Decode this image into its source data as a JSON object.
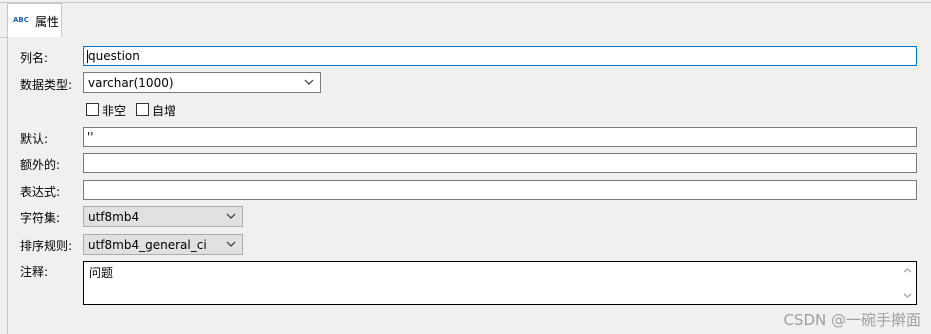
{
  "tab": {
    "icon_text": "ABC",
    "label": "属性"
  },
  "fields": {
    "column_name": {
      "label": "列名:",
      "value": "question"
    },
    "data_type": {
      "label": "数据类型:",
      "value": "varchar(1000)"
    },
    "not_null": {
      "label": "非空",
      "checked": false
    },
    "auto_increment": {
      "label": "自增",
      "checked": false
    },
    "default": {
      "label": "默认:",
      "value": "''"
    },
    "extra": {
      "label": "额外的:",
      "value": ""
    },
    "expression": {
      "label": "表达式:",
      "value": ""
    },
    "charset": {
      "label": "字符集:",
      "value": "utf8mb4"
    },
    "collation": {
      "label": "排序规则:",
      "value": "utf8mb4_general_ci"
    },
    "comment": {
      "label": "注释:",
      "value": "问题"
    }
  },
  "watermark": "CSDN @一碗手擀面",
  "colors": {
    "focus_border": "#0078d7",
    "icon_blue": "#1f5fb0"
  }
}
